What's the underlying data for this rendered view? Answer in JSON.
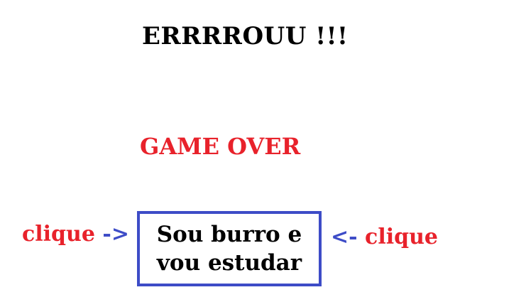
{
  "colors": {
    "text": "#000000",
    "accent": "#e8222b",
    "arrow": "#3d4cc7",
    "button_border": "#3d4cc7",
    "background": "#ffffff"
  },
  "screen": {
    "title": "ERRRROUU !!!",
    "subtitle": "GAME OVER"
  },
  "hint_left": {
    "label": "clique",
    "arrow": "->"
  },
  "hint_right": {
    "arrow": "<-",
    "label": "clique"
  },
  "button": {
    "label": "Sou burro e\nvou estudar"
  }
}
